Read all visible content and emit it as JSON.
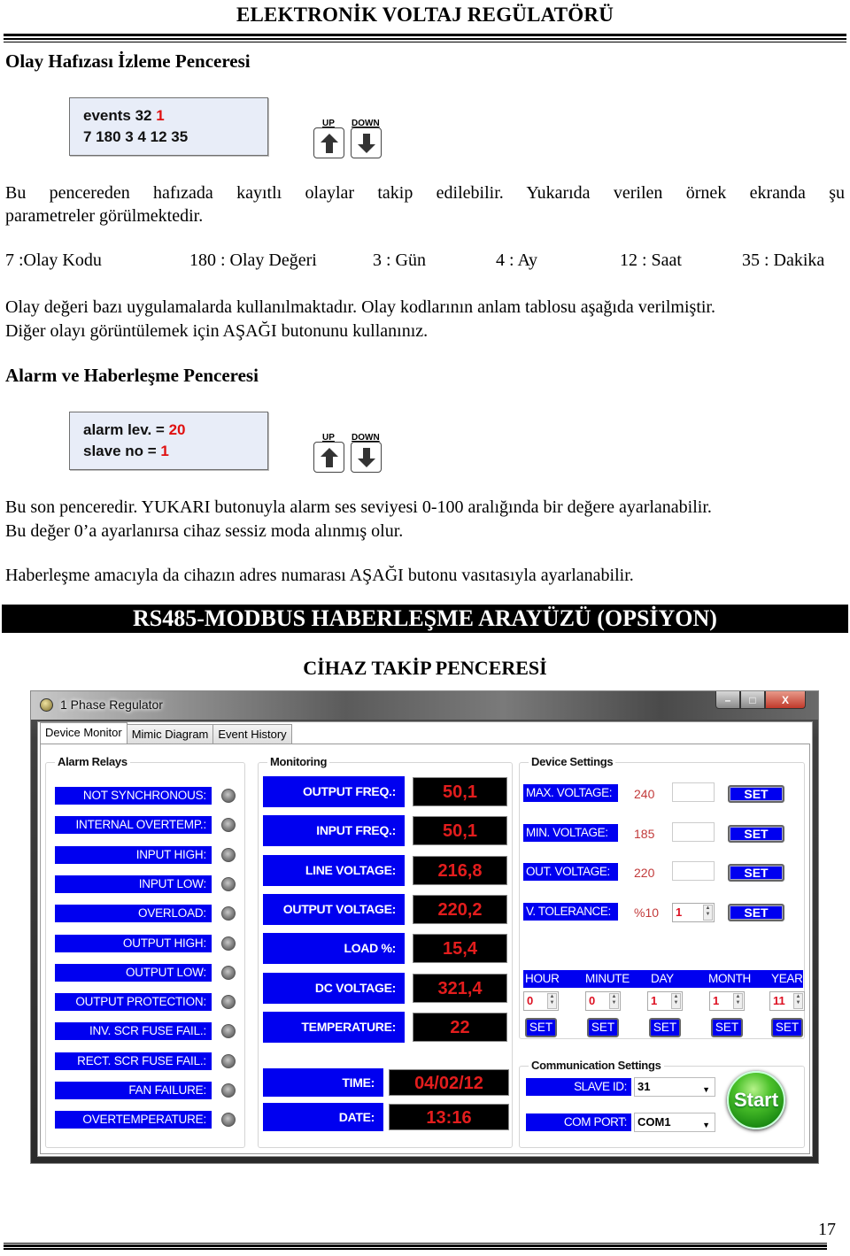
{
  "header": {
    "title": "ELEKTRONİK VOLTAJ REGÜLATÖRÜ"
  },
  "event_section": {
    "heading": "Olay Hafızası İzleme Penceresi",
    "lcd": {
      "line1_label": "events  32 ",
      "line1_value": "1",
      "line2": "7  180  3 4 12 35"
    },
    "buttons": {
      "up_label": "UP",
      "down_label": "DOWN"
    },
    "para1_line1": "Bu pencereden hafızada kayıtlı olaylar takip edilebilir. Yukarıda verilen örnek ekranda şu",
    "para1_line2": "parametreler görülmektedir.",
    "legend": [
      "7 :Olay Kodu",
      "180 : Olay Değeri",
      "3 : Gün",
      "4 : Ay",
      "12 : Saat",
      "35 : Dakika"
    ],
    "para2_line1": "Olay değeri bazı uygulamalarda kullanılmaktadır. Olay kodlarının anlam tablosu aşağıda verilmiştir.",
    "para2_line2": "Diğer olayı görüntülemek için AŞAĞI butonunu kullanınız."
  },
  "alarm_section": {
    "heading": "Alarm ve Haberleşme Penceresi",
    "lcd": {
      "line1_label": "alarm lev. = ",
      "line1_value": "20",
      "line2_label": "slave no = ",
      "line2_value": "1"
    },
    "buttons": {
      "up_label": "UP",
      "down_label": "DOWN"
    },
    "para1_line1": "Bu son penceredir. YUKARI butonuyla alarm ses seviyesi 0-100 aralığında bir değere ayarlanabilir.",
    "para1_line2": "Bu değer 0’a ayarlanırsa cihaz sessiz moda alınmış olur.",
    "para2": "Haberleşme amacıyla da cihazın adres numarası AŞAĞI butonu vasıtasıyla ayarlanabilir."
  },
  "modbus_banner": "RS485-MODBUS HABERLEŞME ARAYÜZÜ (OPSİYON)",
  "monitor_heading": "CİHAZ TAKİP PENCERESİ",
  "app": {
    "window_title": "1 Phase Regulator",
    "window_controls": {
      "min": "–",
      "max": "□",
      "close": "X"
    },
    "tabs": [
      "Device Monitor",
      "Mimic Diagram",
      "Event History"
    ],
    "active_tab": "Device Monitor",
    "alarm_relays": {
      "title": "Alarm Relays",
      "items": [
        "NOT SYNCHRONOUS:",
        "INTERNAL OVERTEMP.:",
        "INPUT HIGH:",
        "INPUT LOW:",
        "OVERLOAD:",
        "OUTPUT HIGH:",
        "OUTPUT LOW:",
        "OUTPUT PROTECTION:",
        "INV. SCR FUSE FAIL.:",
        "RECT. SCR FUSE FAIL.:",
        "FAN FAILURE:",
        "OVERTEMPERATURE:"
      ]
    },
    "monitoring": {
      "title": "Monitoring",
      "items": [
        {
          "label": "OUTPUT FREQ.:",
          "value": "50,1"
        },
        {
          "label": "INPUT FREQ.:",
          "value": "50,1"
        },
        {
          "label": "LINE VOLTAGE:",
          "value": "216,8"
        },
        {
          "label": "OUTPUT VOLTAGE:",
          "value": "220,2"
        },
        {
          "label": "LOAD %:",
          "value": "15,4"
        },
        {
          "label": "DC VOLTAGE:",
          "value": "321,4"
        },
        {
          "label": "TEMPERATURE:",
          "value": "22"
        }
      ],
      "time_label": "TIME:",
      "time_value": "04/02/12",
      "date_label": "DATE:",
      "date_value": "13:16"
    },
    "device_settings": {
      "title": "Device Settings",
      "rows": [
        {
          "label": "MAX. VOLTAGE:",
          "current": "240",
          "input": "",
          "button": "SET"
        },
        {
          "label": "MIN. VOLTAGE:",
          "current": "185",
          "input": "",
          "button": "SET"
        },
        {
          "label": "OUT. VOLTAGE:",
          "current": "220",
          "input": "",
          "button": "SET"
        },
        {
          "label": "V. TOLERANCE:",
          "current": "%10",
          "input": "1",
          "button": "SET"
        }
      ],
      "time_fields": [
        {
          "label": "HOUR",
          "value": "0",
          "button": "SET"
        },
        {
          "label": "MINUTE",
          "value": "0",
          "button": "SET"
        },
        {
          "label": "DAY",
          "value": "1",
          "button": "SET"
        },
        {
          "label": "MONTH",
          "value": "1",
          "button": "SET"
        },
        {
          "label": "YEAR",
          "value": "11",
          "button": "SET"
        }
      ]
    },
    "communication": {
      "title": "Communication Settings",
      "slave_id_label": "SLAVE ID:",
      "slave_id_value": "31",
      "com_port_label": "COM PORT:",
      "com_port_value": "COM1",
      "start_label": "Start"
    }
  },
  "page_number": "17"
}
